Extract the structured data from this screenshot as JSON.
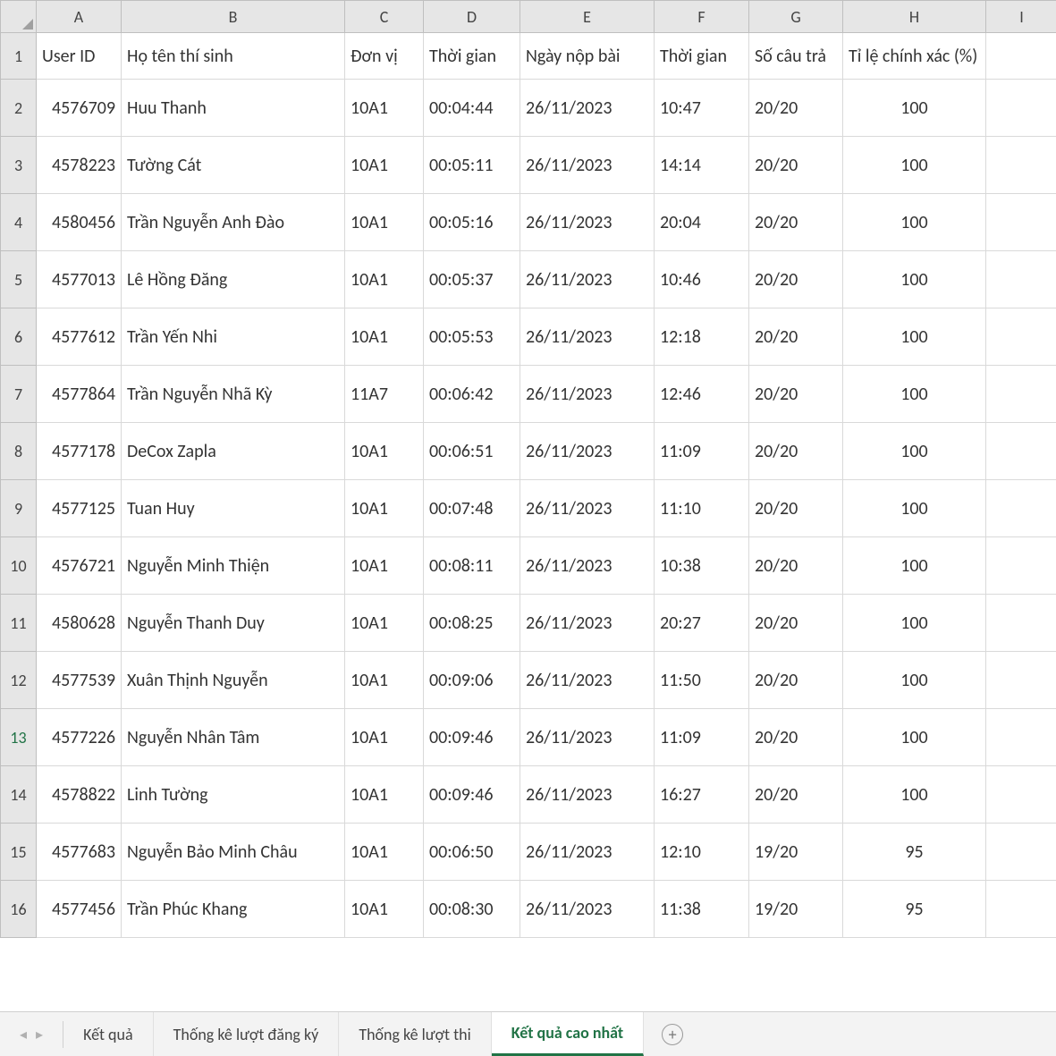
{
  "columns": [
    "A",
    "B",
    "C",
    "D",
    "E",
    "F",
    "G",
    "H",
    "I"
  ],
  "headers": {
    "A": "User ID",
    "B": "Họ tên thí sinh",
    "C": "Đơn vị",
    "D": "Thời gian",
    "E": "Ngày nộp bài",
    "F": "Thời gian",
    "G": "Số câu trả",
    "H": "Tỉ lệ chính xác (%)",
    "I": ""
  },
  "rows": [
    {
      "n": 2,
      "A": "4576709",
      "B": "Huu Thanh",
      "C": "10A1",
      "D": "00:04:44",
      "E": "26/11/2023",
      "F": "10:47",
      "G": "20/20",
      "H": "100"
    },
    {
      "n": 3,
      "A": "4578223",
      "B": "Tường Cát",
      "C": "10A1",
      "D": "00:05:11",
      "E": "26/11/2023",
      "F": "14:14",
      "G": "20/20",
      "H": "100"
    },
    {
      "n": 4,
      "A": "4580456",
      "B": "Trần Nguyễn Anh Đào",
      "C": "10A1",
      "D": "00:05:16",
      "E": "26/11/2023",
      "F": "20:04",
      "G": "20/20",
      "H": "100"
    },
    {
      "n": 5,
      "A": "4577013",
      "B": "Lê Hồng Đăng",
      "C": "10A1",
      "D": "00:05:37",
      "E": "26/11/2023",
      "F": "10:46",
      "G": "20/20",
      "H": "100"
    },
    {
      "n": 6,
      "A": "4577612",
      "B": "Trần Yến Nhi",
      "C": "10A1",
      "D": "00:05:53",
      "E": "26/11/2023",
      "F": "12:18",
      "G": "20/20",
      "H": "100"
    },
    {
      "n": 7,
      "A": "4577864",
      "B": "Trần Nguyễn Nhã Kỳ",
      "C": "11A7",
      "D": "00:06:42",
      "E": "26/11/2023",
      "F": "12:46",
      "G": "20/20",
      "H": "100"
    },
    {
      "n": 8,
      "A": "4577178",
      "B": "DeCox Zapla",
      "C": "10A1",
      "D": "00:06:51",
      "E": "26/11/2023",
      "F": "11:09",
      "G": "20/20",
      "H": "100"
    },
    {
      "n": 9,
      "A": "4577125",
      "B": "Tuan Huy",
      "C": "10A1",
      "D": "00:07:48",
      "E": "26/11/2023",
      "F": "11:10",
      "G": "20/20",
      "H": "100"
    },
    {
      "n": 10,
      "A": "4576721",
      "B": "Nguyễn Minh Thiện",
      "C": "10A1",
      "D": "00:08:11",
      "E": "26/11/2023",
      "F": "10:38",
      "G": "20/20",
      "H": "100"
    },
    {
      "n": 11,
      "A": "4580628",
      "B": "Nguyễn Thanh Duy",
      "C": "10A1",
      "D": "00:08:25",
      "E": "26/11/2023",
      "F": "20:27",
      "G": "20/20",
      "H": "100"
    },
    {
      "n": 12,
      "A": "4577539",
      "B": "Xuân Thịnh Nguyễn",
      "C": "10A1",
      "D": "00:09:06",
      "E": "26/11/2023",
      "F": "11:50",
      "G": "20/20",
      "H": "100"
    },
    {
      "n": 13,
      "A": "4577226",
      "B": "Nguyễn Nhân Tâm",
      "C": "10A1",
      "D": "00:09:46",
      "E": "26/11/2023",
      "F": "11:09",
      "G": "20/20",
      "H": "100"
    },
    {
      "n": 14,
      "A": "4578822",
      "B": "Linh Tường",
      "C": "10A1",
      "D": "00:09:46",
      "E": "26/11/2023",
      "F": "16:27",
      "G": "20/20",
      "H": "100"
    },
    {
      "n": 15,
      "A": "4577683",
      "B": "Nguyễn Bảo Minh Châu",
      "C": "10A1",
      "D": "00:06:50",
      "E": "26/11/2023",
      "F": "12:10",
      "G": "19/20",
      "H": "95"
    },
    {
      "n": 16,
      "A": "4577456",
      "B": "Trần Phúc Khang",
      "C": "10A1",
      "D": "00:08:30",
      "E": "26/11/2023",
      "F": "11:38",
      "G": "19/20",
      "H": "95"
    }
  ],
  "active_row": 13,
  "tabs": [
    {
      "label": "Kết quả",
      "active": false
    },
    {
      "label": "Thống kê lượt đăng ký",
      "active": false
    },
    {
      "label": "Thống kê lượt thi",
      "active": false
    },
    {
      "label": "Kết quả cao nhất",
      "active": true
    }
  ],
  "nav": {
    "prev": "◂",
    "next": "▸"
  },
  "add_tab_icon": "+"
}
